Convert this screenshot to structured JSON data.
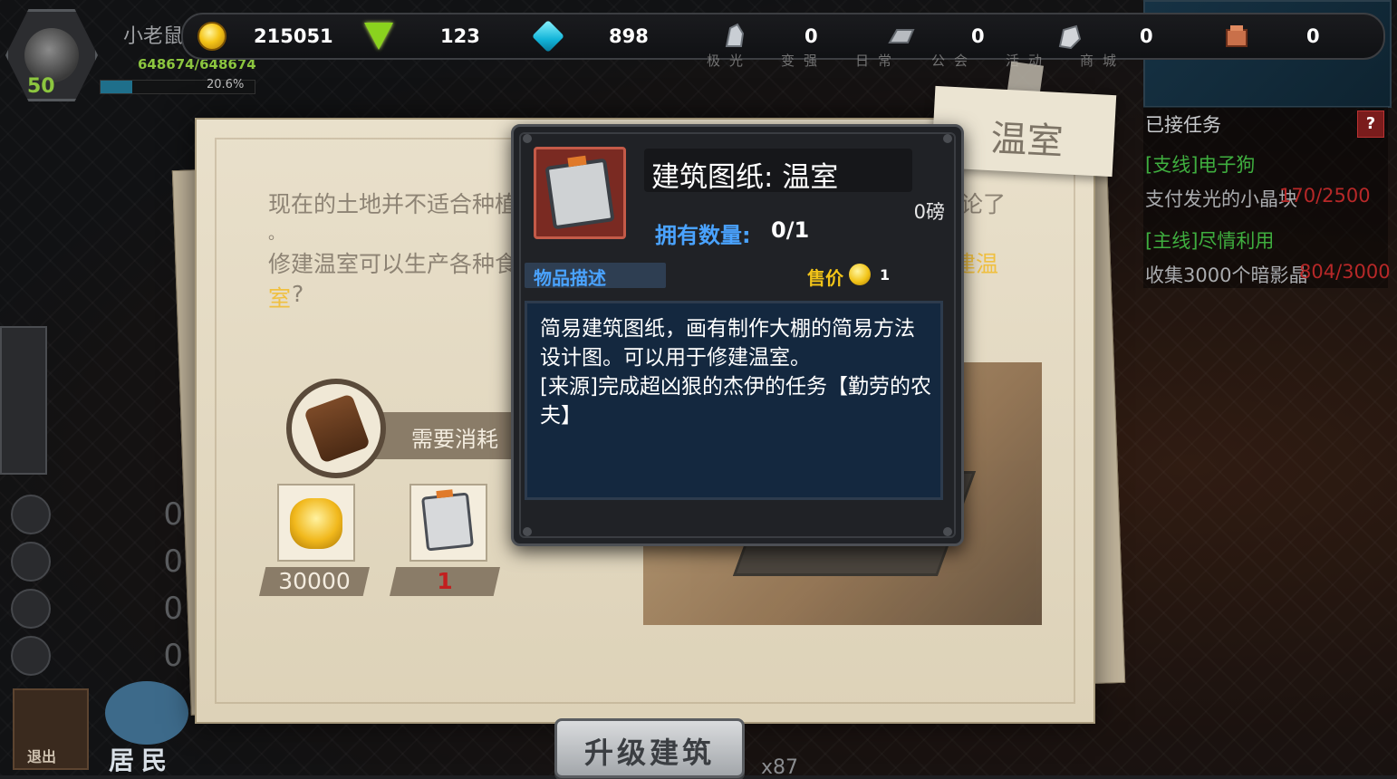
{
  "player": {
    "name": "小老鼠",
    "hp": "648674/648674",
    "level": "50",
    "exp_percent_text": "20.6%",
    "exp_fraction": 0.206
  },
  "resources": [
    {
      "icon": "gold-coin-icon",
      "value": "215051"
    },
    {
      "icon": "green-gem-icon",
      "value": "123"
    },
    {
      "icon": "blue-diamond-icon",
      "value": "898"
    },
    {
      "icon": "crystal-fragment-icon",
      "value": "0"
    },
    {
      "icon": "metal-ingot-icon",
      "value": "0"
    },
    {
      "icon": "silver-ore-icon",
      "value": "0"
    },
    {
      "icon": "red-box-icon",
      "value": "0"
    }
  ],
  "top_tabs": [
    "极光",
    "变强",
    "日常",
    "公会",
    "活动",
    "商城"
  ],
  "quests": {
    "header": "已接任务",
    "help": "?",
    "items": [
      {
        "tag": "[支线]电子狗",
        "desc": "支付发光的小晶块",
        "progress": "170/2500"
      },
      {
        "tag": "[主线]尽情利用",
        "desc": "收集3000个暗影晶",
        "progress": "804/3000"
      }
    ]
  },
  "side_counters": [
    "0",
    "0",
    "0",
    "0"
  ],
  "bottom": {
    "exit": "退出",
    "residents": "居民",
    "count": "x87"
  },
  "notice": {
    "title": "温室",
    "line1": "现在的土地并不适合种植",
    "line1_tail": "论了",
    "line2": "。",
    "line3": "修建温室可以生产各种食",
    "line3_tail_hl": "建温",
    "line4_hl": "室",
    "line4_tail": "?",
    "need_label": "需要消耗",
    "costs": [
      {
        "icon": "gold-coin-stack-icon",
        "value": "30000",
        "color": "#f4ede0"
      },
      {
        "icon": "blueprint-icon",
        "value": "1",
        "color": "#c21f1f"
      }
    ],
    "upgrade_button": "升级建筑"
  },
  "tooltip": {
    "name": "建筑图纸: 温室",
    "weight": "0磅",
    "own_label": "拥有数量:",
    "own_value": "0/1",
    "desc_tab": "物品描述",
    "price_label": "售价",
    "price_value": "1",
    "description": "简易建筑图纸，画有制作大棚的简易方法设计图。可以用于修建温室。\n[来源]完成超凶狠的杰伊的任务【勤劳的农夫】"
  }
}
